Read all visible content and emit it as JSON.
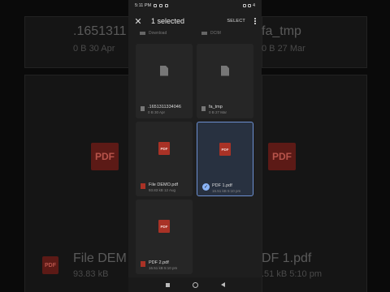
{
  "status_bar": {
    "time": "5:11 PM",
    "battery": "4"
  },
  "appbar": {
    "close_icon": "close-icon",
    "title": "1 selected",
    "select_label": "SELECT",
    "more_icon": "more-vert-icon"
  },
  "prev_row": {
    "left_label": "Download",
    "right_label": "DCIM"
  },
  "files": [
    {
      "name": ".1651311334046",
      "meta": "0 B 30 Apr",
      "type": "doc",
      "selected": false
    },
    {
      "name": "fa_tmp",
      "meta": "0 B 27 Mar",
      "type": "doc",
      "selected": false
    },
    {
      "name": "File DEMO.pdf",
      "meta": "93.83 kB 12 Aug",
      "type": "pdf",
      "selected": false
    },
    {
      "name": "PDF 1.pdf",
      "meta": "16.51 kB 5:10 pm",
      "type": "pdf",
      "selected": true
    },
    {
      "name": "PDF 2.pdf",
      "meta": "16.51 kB 5:10 pm",
      "type": "pdf",
      "selected": false
    }
  ],
  "pdf_label": "PDF",
  "background": {
    "top_left_name": ".1651311",
    "top_left_meta": "0 B 30 Apr",
    "top_right_name": "fa_tmp",
    "top_right_meta": "0 B 27 Mar",
    "bottom_left_name": "File DEM",
    "bottom_left_meta": "93.83 kB",
    "bottom_right_name": "DF 1.pdf",
    "bottom_right_meta": ".51 kB 5:10 pm"
  },
  "colors": {
    "accent": "#8ab4f8",
    "pdf_red": "#a93226",
    "selected_border": "#6c8fd0"
  }
}
